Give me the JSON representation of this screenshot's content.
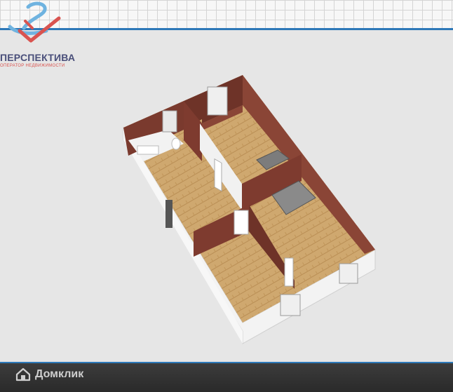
{
  "logo": {
    "title": "ПЕРСПЕКТИВА",
    "subtitle": "ОПЕРАТОР НЕДВИЖИМОСТИ",
    "icon": "logo-icon"
  },
  "watermark": {
    "label": "Домклик",
    "icon": "house-icon"
  },
  "colors": {
    "accent_blue": "#2d78b8",
    "logo_red": "#d9534f",
    "logo_navy": "#4a4f7a",
    "wall": "#7a3a2e",
    "floor": "#c9a36a"
  }
}
